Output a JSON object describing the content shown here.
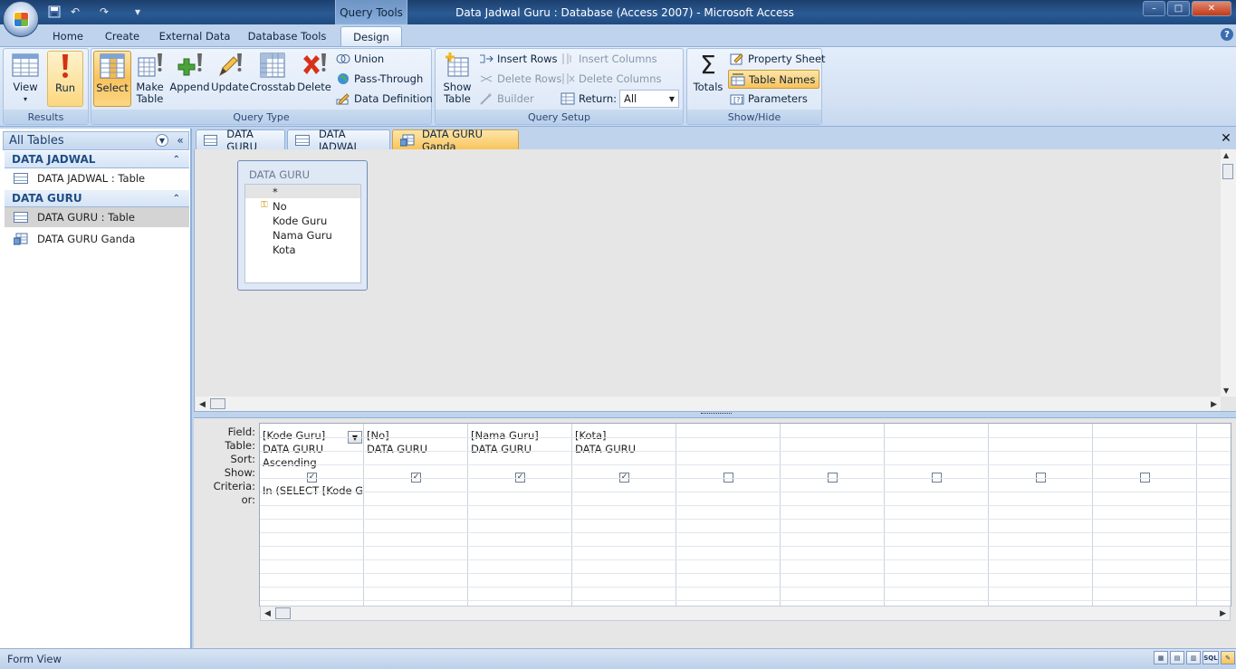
{
  "window": {
    "title": "Data Jadwal Guru : Database (Access 2007) - Microsoft Access",
    "context_tab": "Query Tools",
    "controls": {
      "minimize": "–",
      "maximize": "□",
      "close": "✕"
    }
  },
  "quick_access": {
    "save_icon": "save-icon",
    "undo": "↶",
    "redo": "↷",
    "customize": "▾"
  },
  "ribbon_tabs": [
    "Home",
    "Create",
    "External Data",
    "Database Tools",
    "Design"
  ],
  "active_tab": "Design",
  "help": "?",
  "ribbon": {
    "results": {
      "label": "Results",
      "view": "View",
      "view_arrow": "▾",
      "run": "Run"
    },
    "query_type": {
      "label": "Query Type",
      "select": "Select",
      "make_table_1": "Make",
      "make_table_2": "Table",
      "append": "Append",
      "update": "Update",
      "crosstab": "Crosstab",
      "delete": "Delete",
      "union": "Union",
      "pass_through": "Pass-Through",
      "data_definition": "Data Definition"
    },
    "query_setup": {
      "label": "Query Setup",
      "show_table_1": "Show",
      "show_table_2": "Table",
      "insert_rows": "Insert Rows",
      "delete_rows": "Delete Rows",
      "builder": "Builder",
      "insert_columns": "Insert Columns",
      "delete_columns": "Delete Columns",
      "return_label": "Return:",
      "return_value": "All"
    },
    "show_hide": {
      "label": "Show/Hide",
      "totals": "Totals",
      "totals_symbol": "Σ",
      "property_sheet": "Property Sheet",
      "table_names": "Table Names",
      "parameters": "Parameters"
    }
  },
  "nav_pane": {
    "header": "All Tables",
    "groups": [
      {
        "name": "DATA JADWAL",
        "items": [
          "DATA JADWAL : Table"
        ]
      },
      {
        "name": "DATA GURU",
        "items": [
          "DATA GURU : Table",
          "DATA GURU Ganda"
        ]
      }
    ]
  },
  "doc_tabs": [
    "DATA GURU",
    "DATA JADWAL",
    "DATA GURU Ganda"
  ],
  "active_doc_tab": "DATA GURU Ganda",
  "field_list": {
    "title": "DATA GURU",
    "fields": [
      "*",
      "No",
      "Kode Guru",
      "Nama Guru",
      "Kota"
    ]
  },
  "grid": {
    "row_labels": [
      "Field:",
      "Table:",
      "Sort:",
      "Show:",
      "Criteria:",
      "or:"
    ],
    "columns": [
      {
        "field": "[Kode Guru]",
        "table": "DATA GURU",
        "sort": "Ascending",
        "show": true,
        "criteria": "In (SELECT [Kode Guru"
      },
      {
        "field": "[No]",
        "table": "DATA GURU",
        "sort": "",
        "show": true,
        "criteria": ""
      },
      {
        "field": "[Nama Guru]",
        "table": "DATA GURU",
        "sort": "",
        "show": true,
        "criteria": ""
      },
      {
        "field": "[Kota]",
        "table": "DATA GURU",
        "sort": "",
        "show": true,
        "criteria": ""
      },
      {
        "field": "",
        "table": "",
        "sort": "",
        "show": false,
        "criteria": ""
      },
      {
        "field": "",
        "table": "",
        "sort": "",
        "show": false,
        "criteria": ""
      },
      {
        "field": "",
        "table": "",
        "sort": "",
        "show": false,
        "criteria": ""
      },
      {
        "field": "",
        "table": "",
        "sort": "",
        "show": false,
        "criteria": ""
      },
      {
        "field": "",
        "table": "",
        "sort": "",
        "show": false,
        "criteria": ""
      }
    ]
  },
  "status": {
    "text": "Form View",
    "view_buttons": [
      "SQL"
    ]
  },
  "colors": {
    "accent": "#f9c25c",
    "ribbon_blue": "#bfd3ec",
    "title_blue": "#1f4a80"
  }
}
